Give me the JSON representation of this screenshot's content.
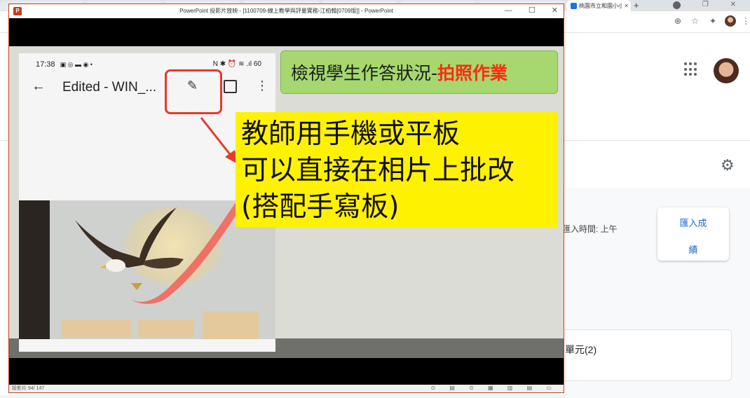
{
  "chrome": {
    "active_tab_title": "桃園市立和園小小",
    "tab_close": "×",
    "new_tab": "+",
    "window_controls": "— ❐ ✕"
  },
  "classroom": {
    "import_time": "匯入時間: 上午",
    "import_button_line1": "匯入成",
    "import_button_line2": "績",
    "unit_label": "單元(2)"
  },
  "ppt": {
    "window_title": "PowerPoint 投影片放映 - [1100709-線上教學與評量實務-江柏翰[0709版]] - PowerPoint",
    "controls": [
      "—",
      "☐",
      "✕"
    ],
    "slide_counter": "投影片 94/ 147",
    "status_icons": "⊙ ▤ ⊙ ▦ ▥ ▤ ▭"
  },
  "slide": {
    "title_prefix": "檢視學生作答狀況-",
    "title_highlight": "拍照作業",
    "callout_lines": [
      "教師用手機或平板",
      "可以直接在相片上批改",
      "(搭配手寫板)"
    ],
    "colors": {
      "title_bg": "#a6d86f",
      "callout_bg": "#fff200",
      "highlight_red": "#ff2a12"
    }
  },
  "phone": {
    "time": "17:38",
    "status_right": "N ✱ ⏰ ≋ .ıl 60",
    "back_icon": "←",
    "file_title": "Edited - WIN_...",
    "edit_icon": "✎",
    "more_icon": "⋮"
  },
  "icons": [
    "search-icon",
    "star-icon",
    "extension-icon",
    "apps-icon",
    "settings-icon",
    "edit-icon",
    "open-in-new-icon",
    "more-vert-icon",
    "back-arrow-icon"
  ]
}
